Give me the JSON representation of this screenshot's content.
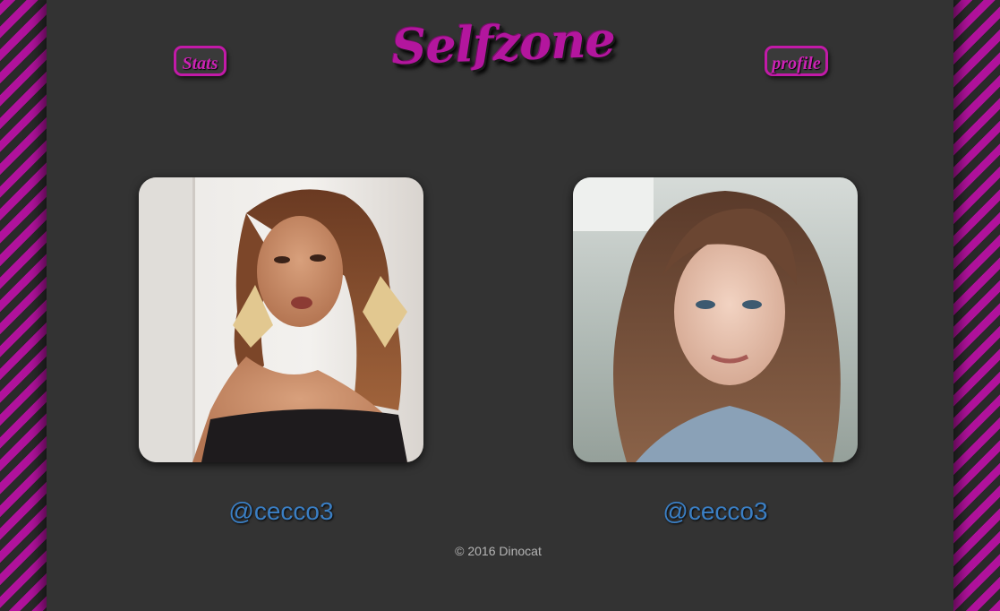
{
  "header": {
    "logo_text": "Selfzone",
    "stats_label": "Stats",
    "profile_label": "profile"
  },
  "photos": [
    {
      "handle": "@cecco3"
    },
    {
      "handle": "@cecco3"
    }
  ],
  "footer": {
    "copyright": "© 2016 Dinocat"
  },
  "colors": {
    "accent": "#b3169e",
    "link": "#3b7fc4",
    "panel": "#333333",
    "stripe_dark": "#2a2a2a"
  }
}
